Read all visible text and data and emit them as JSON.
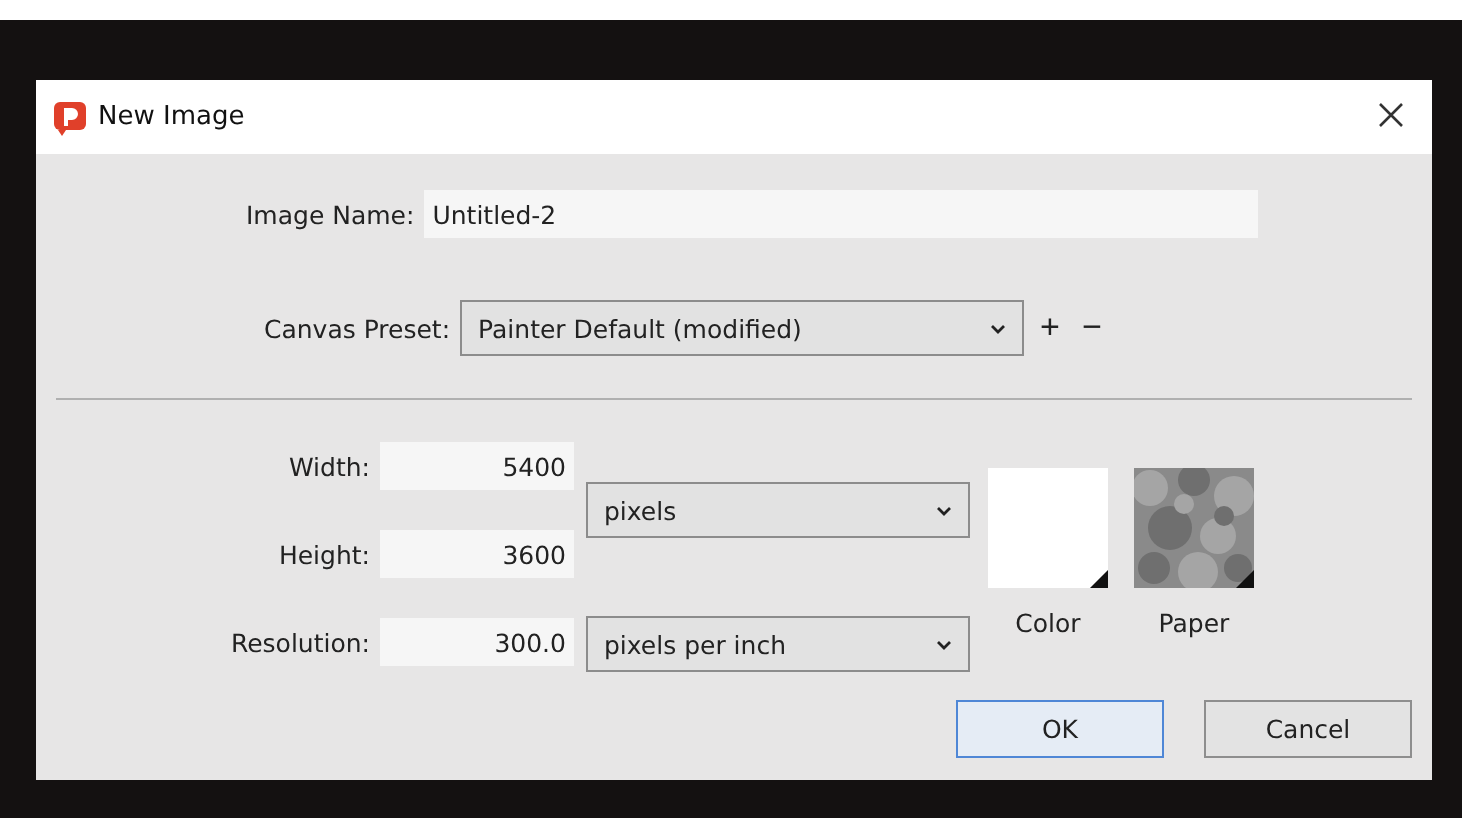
{
  "window": {
    "title": "New Image"
  },
  "image_name": {
    "label": "Image Name:",
    "value": "Untitled-2"
  },
  "canvas_preset": {
    "label": "Canvas Preset:",
    "value": "Painter Default (modified)",
    "add": "+",
    "remove": "−"
  },
  "size_fields": [
    {
      "label": "Width:",
      "value": "5400"
    },
    {
      "label": "Height:",
      "value": "3600"
    },
    {
      "label": "Resolution:",
      "value": "300.0"
    }
  ],
  "size_unit": {
    "value": "pixels"
  },
  "resolution_unit": {
    "value": "pixels per inch"
  },
  "swatches": [
    {
      "kind": "color",
      "label": "Color",
      "color": "#ffffff"
    },
    {
      "kind": "paper",
      "label": "Paper",
      "color": "#8a8a8a"
    }
  ],
  "buttons": [
    {
      "label": "OK",
      "default": true
    },
    {
      "label": "Cancel",
      "default": false
    }
  ]
}
